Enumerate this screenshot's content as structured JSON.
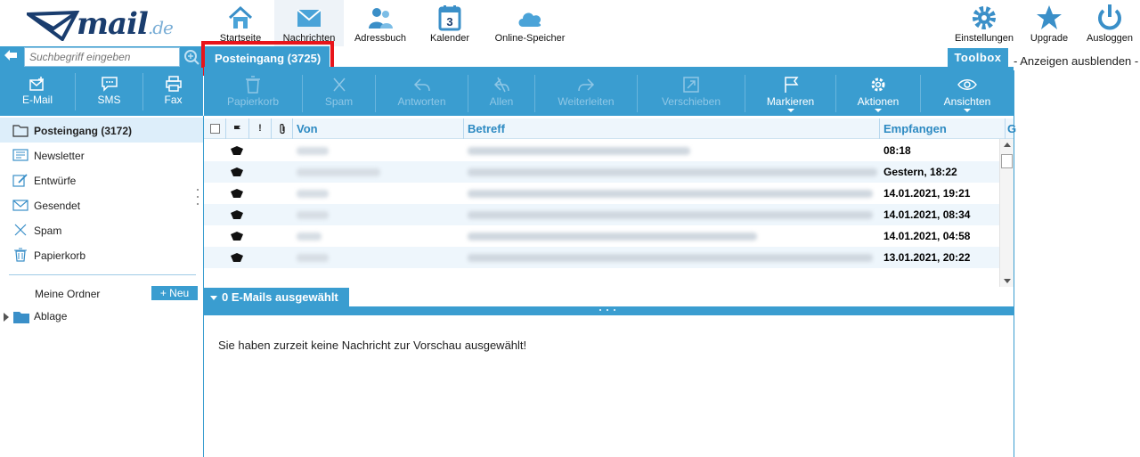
{
  "brand": {
    "logo_main": "mail",
    "logo_suffix": ".de"
  },
  "topnav": {
    "items": [
      {
        "label": "Startseite",
        "icon": "home-icon"
      },
      {
        "label": "Nachrichten",
        "icon": "envelope-icon"
      },
      {
        "label": "Adressbuch",
        "icon": "contacts-icon"
      },
      {
        "label": "Kalender",
        "icon": "calendar-icon",
        "calendar_day": "3"
      },
      {
        "label": "Online-Speicher",
        "icon": "cloud-icon"
      }
    ],
    "right": [
      {
        "label": "Einstellungen",
        "icon": "gear-icon"
      },
      {
        "label": "Upgrade",
        "icon": "star-icon"
      },
      {
        "label": "Ausloggen",
        "icon": "power-icon"
      }
    ]
  },
  "search": {
    "placeholder": "Suchbegriff eingeben"
  },
  "tab_title": "Posteingang (3725)",
  "toolbox": {
    "label": "Toolbox",
    "hide_ads": "- Anzeigen ausblenden -"
  },
  "compose": [
    {
      "label": "E-Mail",
      "icon": "compose-mail-icon"
    },
    {
      "label": "SMS",
      "icon": "sms-icon"
    },
    {
      "label": "Fax",
      "icon": "fax-icon"
    }
  ],
  "toolbar": [
    {
      "label": "Papierkorb",
      "icon": "trash-icon",
      "enabled": false
    },
    {
      "label": "Spam",
      "icon": "spam-icon",
      "enabled": false
    },
    {
      "label": "Antworten",
      "icon": "reply-icon",
      "enabled": false
    },
    {
      "label": "Allen",
      "icon": "reply-all-icon",
      "enabled": false
    },
    {
      "label": "Weiterleiten",
      "icon": "forward-icon",
      "enabled": false
    },
    {
      "label": "Verschieben",
      "icon": "move-icon",
      "enabled": false
    },
    {
      "label": "Markieren",
      "icon": "flag-icon",
      "enabled": true
    },
    {
      "label": "Aktionen",
      "icon": "gear-icon",
      "enabled": true
    },
    {
      "label": "Ansichten",
      "icon": "eye-icon",
      "enabled": true
    }
  ],
  "folders": [
    {
      "label": "Posteingang (3172)",
      "icon": "inbox-folder-icon",
      "active": true
    },
    {
      "label": "Newsletter",
      "icon": "newsletter-icon",
      "active": false
    },
    {
      "label": "Entwürfe",
      "icon": "drafts-icon",
      "active": false
    },
    {
      "label": "Gesendet",
      "icon": "sent-icon",
      "active": false
    },
    {
      "label": "Spam",
      "icon": "spam-icon",
      "active": false
    },
    {
      "label": "Papierkorb",
      "icon": "trash-icon",
      "active": false
    }
  ],
  "my_folders": {
    "label": "Meine Ordner",
    "new_label": "+ Neu",
    "items": [
      {
        "label": "Ablage",
        "icon": "folder-icon"
      }
    ]
  },
  "list": {
    "columns": {
      "from": "Von",
      "subject": "Betreff",
      "received": "Empfangen",
      "extra": "G"
    },
    "rows": [
      {
        "received": "08:18"
      },
      {
        "received": "Gestern, 18:22"
      },
      {
        "received": "14.01.2021, 19:21"
      },
      {
        "received": "14.01.2021, 08:34"
      },
      {
        "received": "14.01.2021, 04:58"
      },
      {
        "received": "13.01.2021, 20:22"
      }
    ]
  },
  "preview": {
    "tab": "0 E-Mails ausgewählt",
    "empty_text": "Sie haben zurzeit keine Nachricht zur Vorschau ausgewählt!"
  },
  "colors": {
    "accent": "#3a9dd0",
    "highlight_border": "#e8141a",
    "row_alt": "#eef6fc"
  }
}
